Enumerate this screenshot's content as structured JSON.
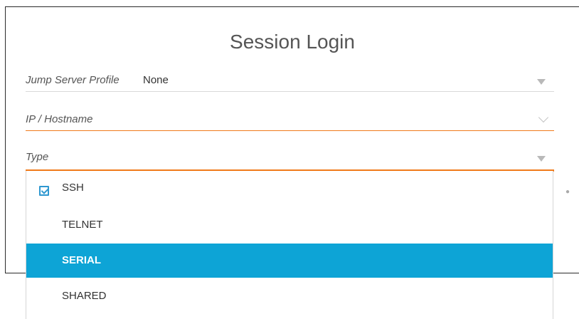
{
  "dialog": {
    "title": "Session Login",
    "fields": {
      "jump_server": {
        "label": "Jump Server Profile",
        "value": "None"
      },
      "ip_hostname": {
        "label": "IP / Hostname",
        "value": ""
      },
      "type": {
        "label": "Type",
        "value": ""
      }
    }
  },
  "dropdown": {
    "options": [
      "SSH",
      "TELNET",
      "SERIAL",
      "SHARED"
    ],
    "checked": "SSH",
    "highlighted": "SERIAL"
  },
  "colors": {
    "focus_accent": "#f07a1a",
    "highlight_bg": "#0da4d6",
    "checkbox": "#2f98d0"
  },
  "icons": [
    "dropdown-arrow-icon",
    "chevron-down-icon",
    "checkbox-checked-icon",
    "asterisk-dot-icon"
  ]
}
